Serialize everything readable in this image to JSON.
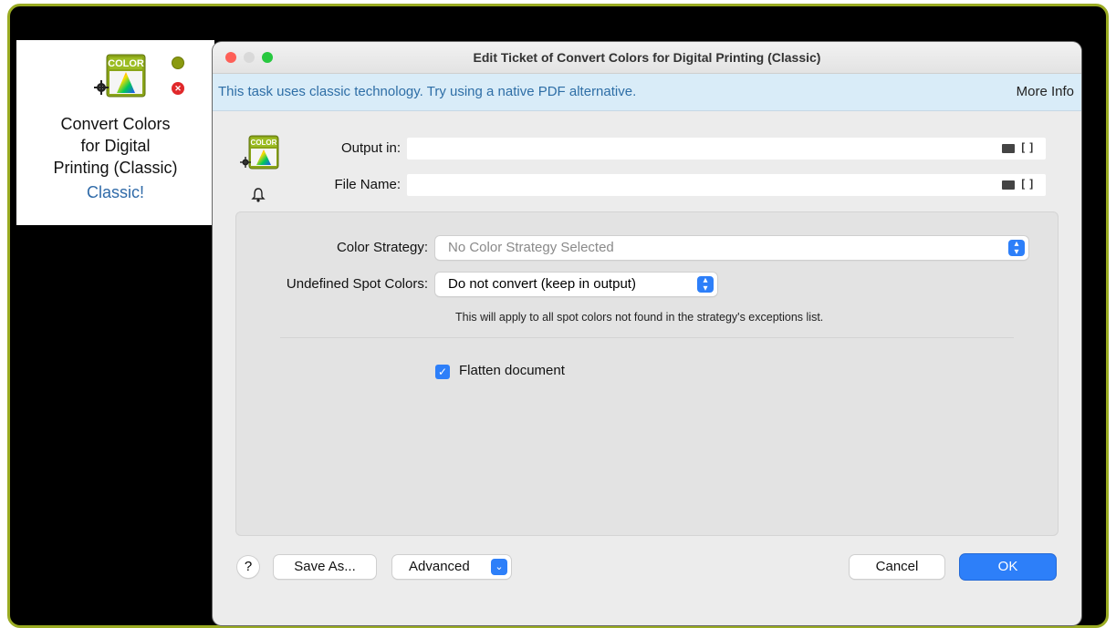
{
  "task_panel": {
    "icon_badge": "COLOR",
    "title_lines": [
      "Convert Colors",
      "for Digital",
      "Printing (Classic)"
    ],
    "subtitle": "Classic!"
  },
  "dialog": {
    "title": "Edit Ticket of Convert Colors for Digital Printing (Classic)",
    "info_banner": {
      "text": "This task uses classic technology. Try using a native PDF alternative.",
      "link": "More Info"
    },
    "icon_badge": "COLOR",
    "output_in": {
      "label": "Output in:",
      "value": ""
    },
    "file_name": {
      "label": "File Name:",
      "value": ""
    },
    "color_strategy": {
      "label": "Color Strategy:",
      "value": "No Color Strategy Selected"
    },
    "undefined_spot_colors": {
      "label": "Undefined Spot Colors:",
      "value": "Do not convert (keep in output)",
      "hint": "This will apply to all spot colors not found in the strategy's exceptions list."
    },
    "flatten": {
      "label": "Flatten document",
      "checked": true
    },
    "buttons": {
      "help": "?",
      "save_as": "Save As...",
      "advanced": "Advanced",
      "cancel": "Cancel",
      "ok": "OK"
    }
  },
  "colors": {
    "frame_border": "#9aab22",
    "accent": "#2d7ff9",
    "info_bg": "#d9ecf8",
    "info_text": "#2e6ea6",
    "classic_text": "#2f6aa8"
  },
  "icons": [
    "color-wheel-icon",
    "gear-icon",
    "status-dot-icon",
    "error-icon",
    "bell-icon",
    "folder-icon",
    "variable-brackets-icon",
    "chevron-updown-icon",
    "chevron-down-icon",
    "checkmark-icon"
  ]
}
